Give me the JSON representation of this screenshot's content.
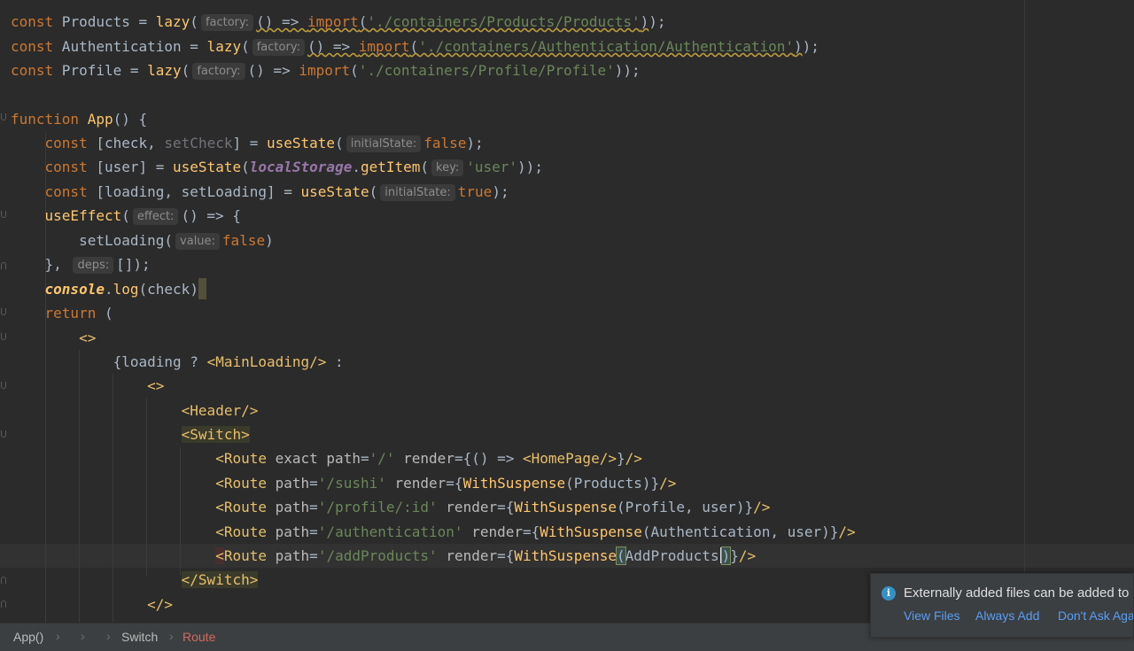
{
  "editor": {
    "line_numbers_hidden": true
  },
  "hints": {
    "factory": "factory:",
    "initialState": "initialState:",
    "key": "key:",
    "effect": "effect:",
    "value": "value:",
    "deps": "deps:"
  },
  "breadcrumbs": {
    "items": [
      "App()",
      "",
      "Switch",
      "Route"
    ]
  },
  "notification": {
    "message": "Externally added files can be added to Git",
    "actions": [
      "View Files",
      "Always Add",
      "Don't Ask Again"
    ]
  }
}
